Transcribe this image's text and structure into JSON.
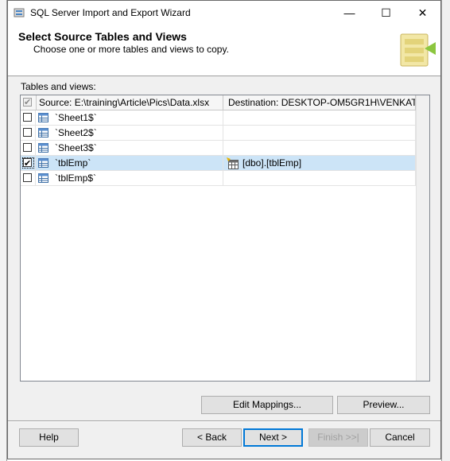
{
  "window": {
    "title": "SQL Server Import and Export Wizard",
    "controls": {
      "minimize": "—",
      "maximize": "☐",
      "close": "✕"
    }
  },
  "header": {
    "title": "Select Source Tables and Views",
    "subtitle": "Choose one or more tables and views to copy."
  },
  "list": {
    "label": "Tables and views:",
    "columns": {
      "source": "Source: E:\\training\\Article\\Pics\\Data.xlsx",
      "destination": "Destination: DESKTOP-OM5GR1H\\VENKAT"
    },
    "rows": [
      {
        "source": "`Sheet1$`",
        "destination": "",
        "checked": false,
        "selected": false
      },
      {
        "source": "`Sheet2$`",
        "destination": "",
        "checked": false,
        "selected": false
      },
      {
        "source": "`Sheet3$`",
        "destination": "",
        "checked": false,
        "selected": false
      },
      {
        "source": "`tblEmp`",
        "destination": "[dbo].[tblEmp]",
        "checked": true,
        "selected": true
      },
      {
        "source": "`tblEmp$`",
        "destination": "",
        "checked": false,
        "selected": false
      }
    ]
  },
  "buttons": {
    "edit_mappings": "Edit Mappings...",
    "preview": "Preview...",
    "help": "Help",
    "back": "< Back",
    "next": "Next >",
    "finish": "Finish >>|",
    "cancel": "Cancel"
  },
  "icons": {
    "app": "wizard-icon",
    "table": "table-icon",
    "destination_table": "new-table-icon",
    "header_logo": "import-export-logo"
  },
  "colors": {
    "selection": "#cce4f7",
    "default_button_border": "#0078d7"
  }
}
